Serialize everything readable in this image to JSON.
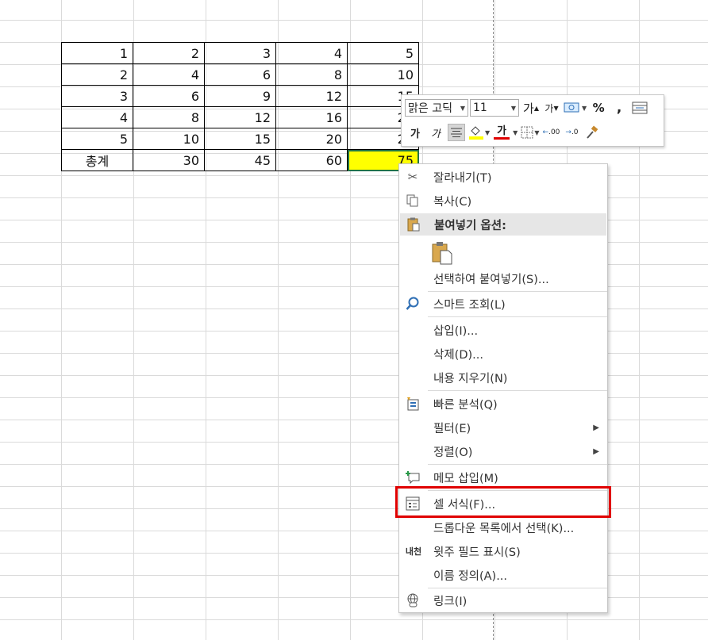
{
  "sheet": {
    "rows": [
      [
        "1",
        "2",
        "3",
        "4",
        "5"
      ],
      [
        "2",
        "4",
        "6",
        "8",
        "10"
      ],
      [
        "3",
        "6",
        "9",
        "12",
        "15"
      ],
      [
        "4",
        "8",
        "12",
        "16",
        "20"
      ],
      [
        "5",
        "10",
        "15",
        "20",
        "25"
      ],
      [
        "총계",
        "30",
        "45",
        "60",
        "75"
      ]
    ],
    "highlight_color": "#ffff00",
    "selection_border_color": "#217346"
  },
  "mini_toolbar": {
    "font_name": "맑은 고딕",
    "font_size": "11",
    "increase_font": "가",
    "decrease_font": "가",
    "percent": "%",
    "comma": ",",
    "bold": "가",
    "italic": "가",
    "font_color_glyph": "가",
    "font_color": "#e00000",
    "fill_color": "#ffff00",
    "inc_decimal": ".00",
    "dec_decimal": ".0"
  },
  "context_menu": {
    "items": [
      {
        "label": "잘라내기(T)",
        "icon": "scissors-icon"
      },
      {
        "label": "복사(C)",
        "icon": "copy-icon"
      },
      {
        "label": "붙여넣기 옵션:",
        "icon": "clipboard-icon"
      },
      {
        "label": "선택하여 붙여넣기(S)...",
        "icon": ""
      },
      {
        "label": "스마트 조회(L)",
        "icon": "smart-lookup-icon"
      },
      {
        "label": "삽입(I)...",
        "icon": ""
      },
      {
        "label": "삭제(D)...",
        "icon": ""
      },
      {
        "label": "내용 지우기(N)",
        "icon": ""
      },
      {
        "label": "빠른 분석(Q)",
        "icon": "quick-analysis-icon"
      },
      {
        "label": "필터(E)",
        "icon": ""
      },
      {
        "label": "정렬(O)",
        "icon": ""
      },
      {
        "label": "메모 삽입(M)",
        "icon": "comment-icon"
      },
      {
        "label": "셀 서식(F)...",
        "icon": "format-cells-icon"
      },
      {
        "label": "드롭다운 목록에서 선택(K)...",
        "icon": ""
      },
      {
        "label": "윗주 필드 표시(S)",
        "icon": "phonetic-icon"
      },
      {
        "label": "이름 정의(A)...",
        "icon": ""
      },
      {
        "label": "링크(I)",
        "icon": "link-icon"
      }
    ],
    "phonetic_glyph": "내천",
    "highlight_box_color": "#e00000"
  }
}
